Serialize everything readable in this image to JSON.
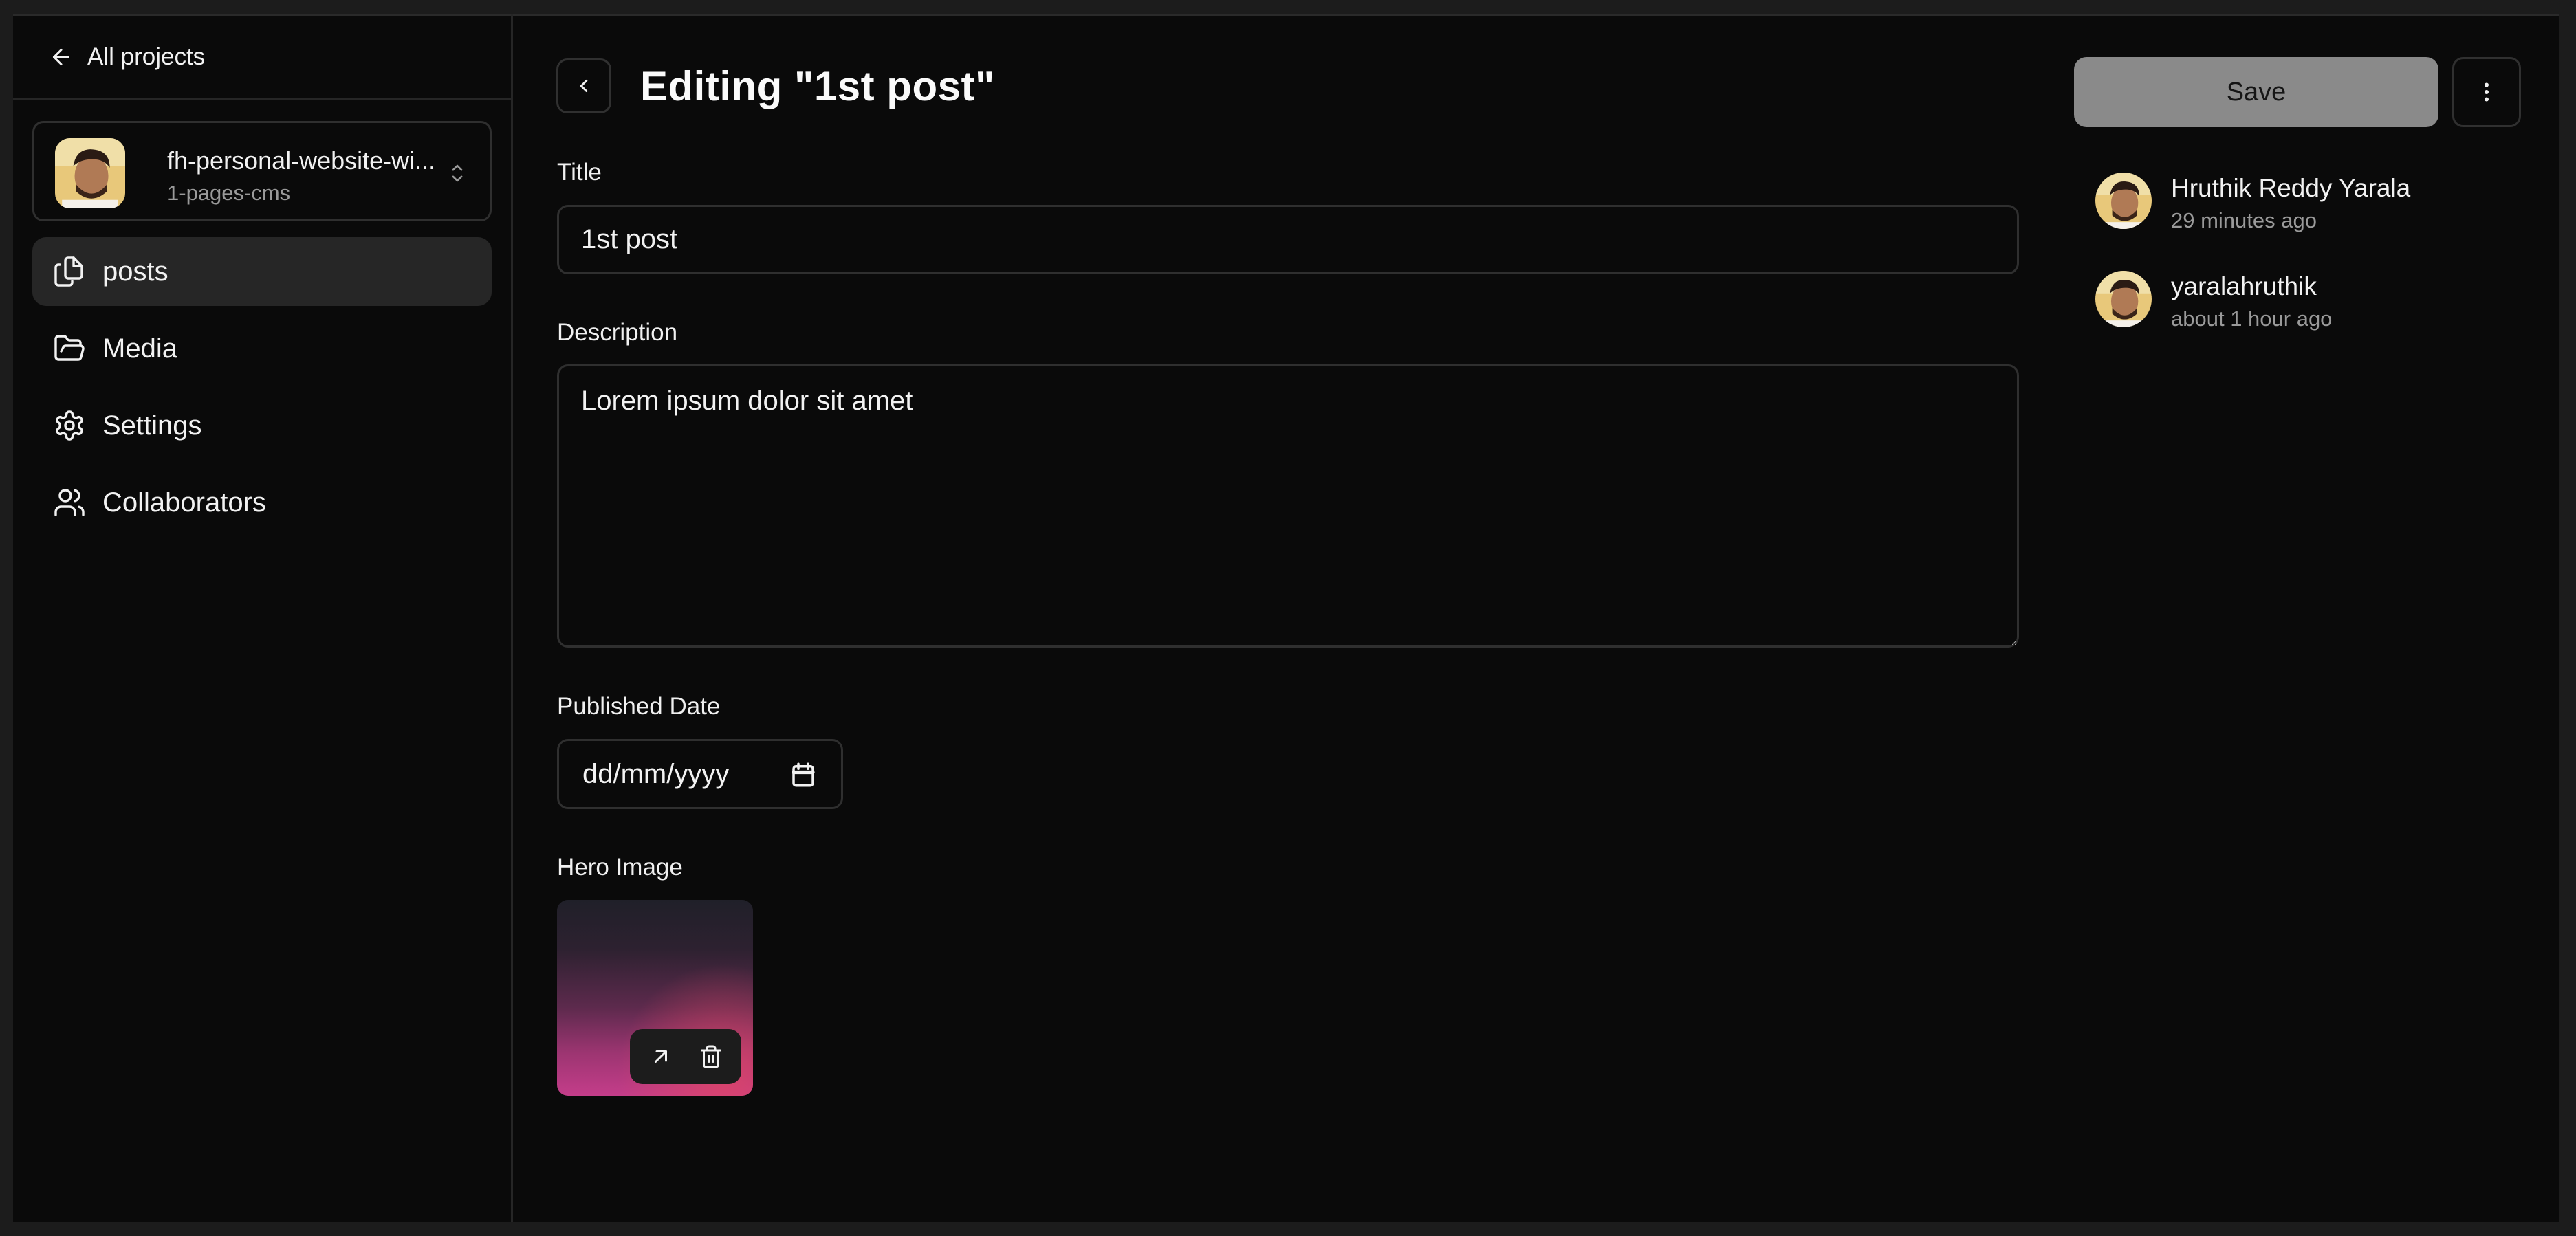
{
  "sidebar": {
    "back_link": "All projects",
    "project": {
      "name": "fh-personal-website-wi...",
      "branch": "1-pages-cms"
    },
    "items": [
      {
        "label": "posts",
        "icon": "files-icon",
        "active": true
      },
      {
        "label": "Media",
        "icon": "folder-open-icon",
        "active": false
      },
      {
        "label": "Settings",
        "icon": "gear-icon",
        "active": false
      },
      {
        "label": "Collaborators",
        "icon": "users-icon",
        "active": false
      }
    ]
  },
  "main": {
    "title": "Editing \"1st post\"",
    "fields": {
      "title": {
        "label": "Title",
        "value": "1st post"
      },
      "description": {
        "label": "Description",
        "value": "Lorem ipsum dolor sit amet"
      },
      "published_date": {
        "label": "Published Date",
        "placeholder": "dd/mm/yyyy"
      },
      "hero_image": {
        "label": "Hero Image"
      }
    }
  },
  "actions": {
    "save_label": "Save"
  },
  "history": [
    {
      "name": "Hruthik Reddy Yarala",
      "time": "29 minutes ago"
    },
    {
      "name": "yaralahruthik",
      "time": "about 1 hour ago"
    }
  ],
  "colors": {
    "background": "#0a0a0a",
    "border": "#2f2f2f",
    "active_nav": "#262626",
    "save_button": "#8a8a8a"
  }
}
